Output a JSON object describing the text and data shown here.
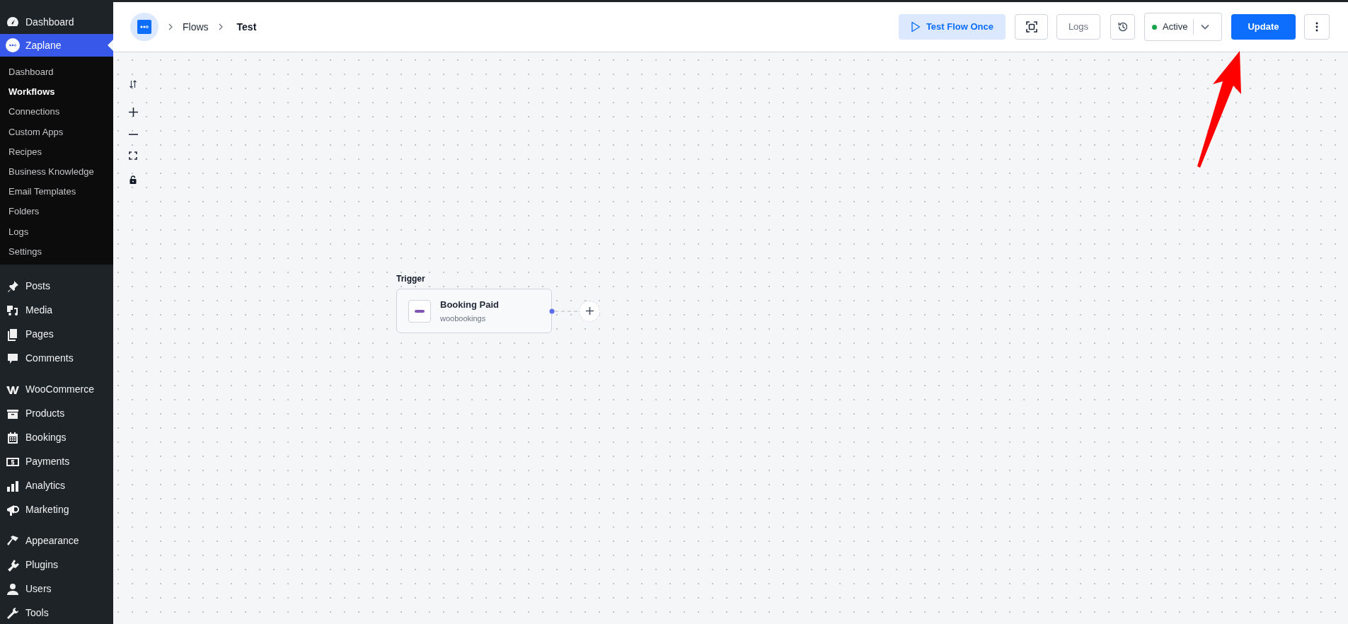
{
  "sidebar": {
    "groups": [
      {
        "items": [
          {
            "label": "Dashboard",
            "selected": false
          },
          {
            "label": "Zaplane",
            "selected": true,
            "children": [
              {
                "label": "Dashboard",
                "selected": false
              },
              {
                "label": "Workflows",
                "selected": true
              },
              {
                "label": "Connections",
                "selected": false
              },
              {
                "label": "Custom Apps",
                "selected": false
              },
              {
                "label": "Recipes",
                "selected": false
              },
              {
                "label": "Business Knowledge",
                "selected": false
              },
              {
                "label": "Email Templates",
                "selected": false
              },
              {
                "label": "Folders",
                "selected": false
              },
              {
                "label": "Logs",
                "selected": false
              },
              {
                "label": "Settings",
                "selected": false
              }
            ]
          }
        ]
      },
      {
        "items": [
          {
            "label": "Posts",
            "selected": false
          },
          {
            "label": "Media",
            "selected": false
          },
          {
            "label": "Pages",
            "selected": false
          },
          {
            "label": "Comments",
            "selected": false
          }
        ]
      },
      {
        "items": [
          {
            "label": "WooCommerce",
            "selected": false
          },
          {
            "label": "Products",
            "selected": false
          },
          {
            "label": "Bookings",
            "selected": false
          },
          {
            "label": "Payments",
            "selected": false
          },
          {
            "label": "Analytics",
            "selected": false
          },
          {
            "label": "Marketing",
            "selected": false
          }
        ]
      },
      {
        "items": [
          {
            "label": "Appearance",
            "selected": false
          },
          {
            "label": "Plugins",
            "selected": false
          },
          {
            "label": "Users",
            "selected": false
          },
          {
            "label": "Tools",
            "selected": false
          }
        ]
      }
    ]
  },
  "breadcrumb": [
    "Flows",
    "Test"
  ],
  "toolbar": {
    "test_button": "Test Flow Once",
    "logs_button": "Logs",
    "status": {
      "label": "Active",
      "on": true
    },
    "update_button": "Update"
  },
  "canvas": {
    "nodes": [
      {
        "kind": "trigger",
        "heading": "Trigger",
        "title": "Booking Paid",
        "subtitle": "woobookings"
      }
    ]
  }
}
